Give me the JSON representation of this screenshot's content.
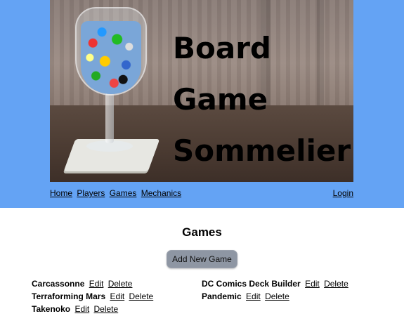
{
  "banner": {
    "title_lines": [
      "Board",
      "Game",
      "Sommelier"
    ]
  },
  "nav": {
    "items": [
      {
        "label": "Home"
      },
      {
        "label": "Players"
      },
      {
        "label": "Games"
      },
      {
        "label": "Mechanics"
      }
    ],
    "login_label": "Login"
  },
  "main": {
    "title": "Games",
    "add_button_label": "Add New Game",
    "edit_label": "Edit",
    "delete_label": "Delete",
    "games": [
      {
        "name": "Carcassonne"
      },
      {
        "name": "DC Comics Deck Builder"
      },
      {
        "name": "Terraforming Mars"
      },
      {
        "name": "Pandemic"
      },
      {
        "name": "Takenoko"
      }
    ]
  },
  "colors": {
    "header_background": "#64a3f4",
    "button_background": "#8e96a3"
  }
}
